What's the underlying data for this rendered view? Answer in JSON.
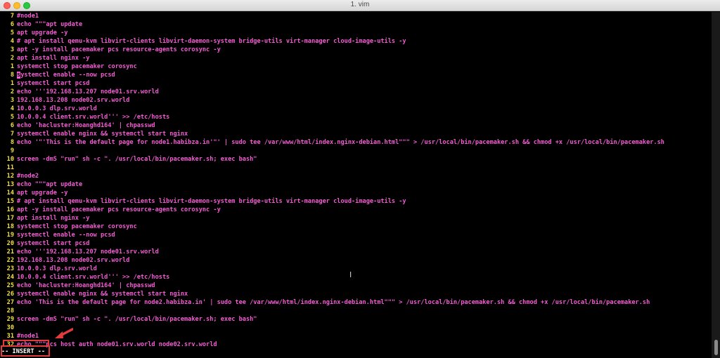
{
  "window": {
    "title": "1. vim"
  },
  "lines": [
    {
      "num": "7",
      "text": "#node1"
    },
    {
      "num": "6",
      "text": "echo \"\"\"apt update"
    },
    {
      "num": "5",
      "text": "apt upgrade -y"
    },
    {
      "num": "4",
      "text": "# apt install qemu-kvm libvirt-clients libvirt-daemon-system bridge-utils virt-manager cloud-image-utils -y"
    },
    {
      "num": "3",
      "text": "apt -y install pacemaker pcs resource-agents corosync -y"
    },
    {
      "num": "2",
      "text": "apt install nginx -y"
    },
    {
      "num": "1",
      "text": "systemctl stop pacemaker corosync"
    },
    {
      "num": "8",
      "text": "systemctl enable --now pcsd",
      "cursor": true
    },
    {
      "num": "1",
      "text": "systemctl start pcsd"
    },
    {
      "num": "2",
      "text": "echo '''192.168.13.207 node01.srv.world"
    },
    {
      "num": "3",
      "text": "192.168.13.208 node02.srv.world"
    },
    {
      "num": "4",
      "text": "10.0.0.3 dlp.srv.world"
    },
    {
      "num": "5",
      "text": "10.0.0.4 client.srv.world''' >> /etc/hosts"
    },
    {
      "num": "6",
      "text": "echo 'hacluster:Hoanghd164' | chpasswd"
    },
    {
      "num": "7",
      "text": "systemctl enable nginx && systemctl start nginx"
    },
    {
      "num": "8",
      "text": "echo '\"'This is the default page for node1.habibza.in'\"' | sudo tee /var/www/html/index.nginx-debian.html\"\"\" > /usr/local/bin/pacemaker.sh && chmod +x /usr/local/bin/pacemaker.sh"
    },
    {
      "num": "9",
      "text": ""
    },
    {
      "num": "10",
      "text": "screen -dmS \"run\" sh -c \". /usr/local/bin/pacemaker.sh; exec bash\""
    },
    {
      "num": "11",
      "text": ""
    },
    {
      "num": "12",
      "text": "#node2"
    },
    {
      "num": "13",
      "text": "echo \"\"\"apt update"
    },
    {
      "num": "14",
      "text": "apt upgrade -y"
    },
    {
      "num": "15",
      "text": "# apt install qemu-kvm libvirt-clients libvirt-daemon-system bridge-utils virt-manager cloud-image-utils -y"
    },
    {
      "num": "16",
      "text": "apt -y install pacemaker pcs resource-agents corosync -y"
    },
    {
      "num": "17",
      "text": "apt install nginx -y"
    },
    {
      "num": "18",
      "text": "systemctl stop pacemaker corosync"
    },
    {
      "num": "19",
      "text": "systemctl enable --now pcsd"
    },
    {
      "num": "20",
      "text": "systemctl start pcsd"
    },
    {
      "num": "21",
      "text": "echo '''192.168.13.207 node01.srv.world"
    },
    {
      "num": "22",
      "text": "192.168.13.208 node02.srv.world"
    },
    {
      "num": "23",
      "text": "10.0.0.3 dlp.srv.world"
    },
    {
      "num": "24",
      "text": "10.0.0.4 client.srv.world''' >> /etc/hosts"
    },
    {
      "num": "25",
      "text": "echo 'hacluster:Hoanghd164' | chpasswd"
    },
    {
      "num": "26",
      "text": "systemctl enable nginx && systemctl start nginx"
    },
    {
      "num": "27",
      "text": "echo 'This is the default page for node2.habibza.in' | sudo tee /var/www/html/index.nginx-debian.html\"\"\" > /usr/local/bin/pacemaker.sh && chmod +x /usr/local/bin/pacemaker.sh"
    },
    {
      "num": "28",
      "text": ""
    },
    {
      "num": "29",
      "text": "screen -dmS \"run\" sh -c \". /usr/local/bin/pacemaker.sh; exec bash\""
    },
    {
      "num": "30",
      "text": ""
    },
    {
      "num": "31",
      "text": "#node1"
    },
    {
      "num": "32",
      "text": "echo \"\"\"pcs host auth node01.srv.world node02.srv.world"
    }
  ],
  "status": {
    "mode": "-- INSERT --"
  },
  "colors": {
    "line_number": "#f3e23c",
    "code": "#f45bd4",
    "background": "#000000",
    "annotation": "#e23b3b"
  },
  "icons": {
    "close": "close-dot-icon",
    "minimize": "minimize-dot-icon",
    "maximize": "maximize-dot-icon",
    "arrow": "red-arrow-icon",
    "text_cursor": "ibeam-cursor-icon"
  }
}
